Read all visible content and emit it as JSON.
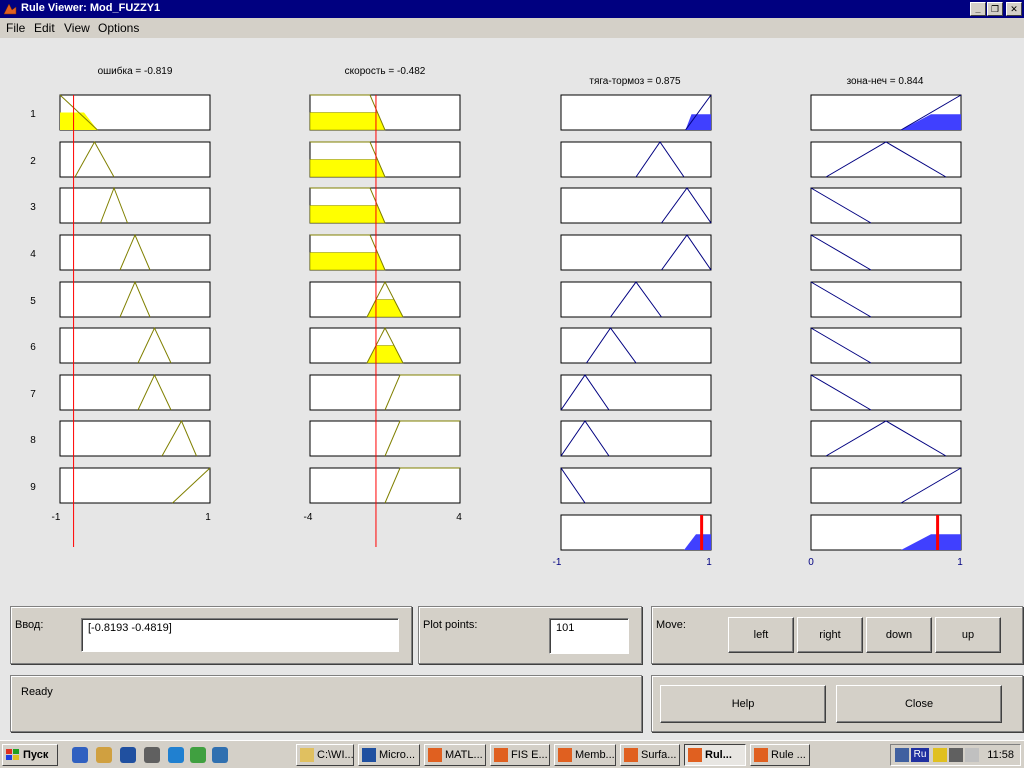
{
  "window": {
    "title": "Rule Viewer: Mod_FUZZY1",
    "minimize": "_",
    "restore": "❐",
    "close": "✕"
  },
  "menu": [
    "File",
    "Edit",
    "View",
    "Options"
  ],
  "plot": {
    "input1_header": "ошибка = -0.819",
    "input2_header": "скорость = -0.482",
    "output1_header": "тяга-тормоз = 0.875",
    "output2_header": "зона-неч = 0.844",
    "rule_numbers": [
      "1",
      "2",
      "3",
      "4",
      "5",
      "6",
      "7",
      "8",
      "9"
    ],
    "input1_range": [
      "-1",
      "1"
    ],
    "input2_range": [
      "-4",
      "4"
    ],
    "output1_range": [
      "-1",
      "1"
    ],
    "output2_range": [
      "0",
      "1"
    ],
    "input1_value": -0.819,
    "input2_value": -0.482,
    "output1_value": 0.875,
    "output2_value": 0.844,
    "colors": {
      "input_fill": "#ffff00",
      "input_line": "#808000",
      "output_fill": "#4040ff",
      "output_line": "#000080",
      "cursor": "#ff0000"
    }
  },
  "controls": {
    "input_label": "Ввод:",
    "input_value": "[-0.8193 -0.4819]",
    "plot_points_label": "Plot points:",
    "plot_points_value": "101",
    "move_label": "Move:",
    "left": "left",
    "right": "right",
    "down": "down",
    "up": "up",
    "status": "Ready",
    "help": "Help",
    "close": "Close"
  },
  "taskbar": {
    "start": "Пуск",
    "tasks": [
      "C:\\WI...",
      "Micro...",
      "MATL...",
      "FIS E...",
      "Memb...",
      "Surfa...",
      "Rul...",
      "Rule ..."
    ],
    "tray_lang": "Ru",
    "clock": "11:58"
  }
}
